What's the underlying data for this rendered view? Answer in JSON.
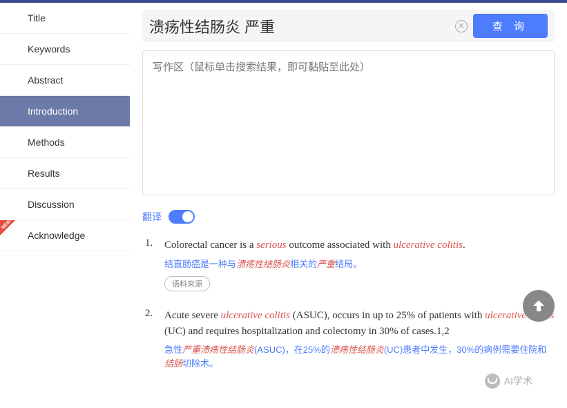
{
  "sidebar": {
    "items": [
      {
        "label": "Title"
      },
      {
        "label": "Keywords"
      },
      {
        "label": "Abstract"
      },
      {
        "label": "Introduction"
      },
      {
        "label": "Methods"
      },
      {
        "label": "Results"
      },
      {
        "label": "Discussion"
      },
      {
        "label": "Acknowledge"
      }
    ]
  },
  "search": {
    "value": "溃疡性结肠炎 严重",
    "query_label": "查 询"
  },
  "writing": {
    "placeholder": "写作区（鼠标单击搜索结果，即可黏贴至此处）"
  },
  "translate": {
    "label": "翻译"
  },
  "results": [
    {
      "num": "1.",
      "en_pre": "Colorectal cancer is a ",
      "en_hl1": "serious",
      "en_mid": " outcome associated with ",
      "en_hl2": "ulcerative colitis",
      "en_post": ".",
      "zh_pre": "结直肠癌是一种与",
      "zh_hl1": "溃疡性结肠炎",
      "zh_mid": "相关的",
      "zh_hl2": "严重",
      "zh_post": "结局。",
      "source": "语料来源"
    },
    {
      "num": "2.",
      "en_pre": "Acute severe ",
      "en_hl1": "ulcerative colitis",
      "en_mid": " (ASUC), occurs in up to 25% of patients with ",
      "en_hl2": "ulcerative colitis",
      "en_post": " (UC) and requires hospitalization and colectomy in 30% of cases.1,2",
      "zh_pre": "急性",
      "zh_hl1": "严重溃疡性结肠炎",
      "zh_mid": "(ASUC)，在25%的",
      "zh_hl2": "溃疡性结肠炎",
      "zh_mid2": "(UC)患者中发生，30%的病例需要住院和",
      "zh_hl3": "结肠",
      "zh_post": "切除术。"
    }
  ],
  "watermark": "AI学术"
}
